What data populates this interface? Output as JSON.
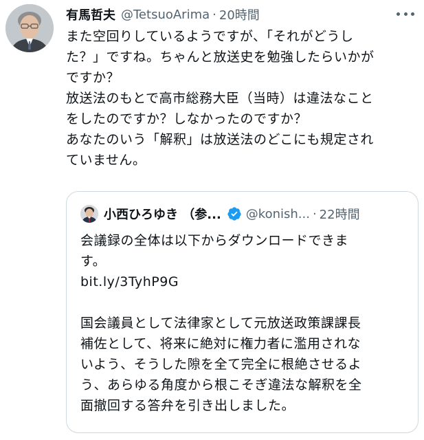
{
  "tweet": {
    "display_name": "有馬哲夫",
    "handle": "@TetsuoArima",
    "separator": "·",
    "time": "20時間",
    "lines": [
      "また空回りしているようですが、「それがどうし",
      "た？」ですね。ちゃんと放送史を勉強したらいかが",
      "ですか？",
      "放送法のもとで高市総務大臣（当時）は違法なこと",
      "をしたのですか？しなかったのですか？",
      "あなたのいう「解釈」は放送法のどこにも規定され",
      "ていません。"
    ]
  },
  "quoted": {
    "display_name": "小西ひろゆき （参...",
    "handle": "@konish...",
    "separator": "·",
    "time": "22時間",
    "lines": [
      "会議録の全体は以下からダウンロードできま",
      "す。",
      "bit.ly/3TyhP9G",
      "",
      "国会議員として法律家として元放送政策課課長",
      "補佐として、将来に絶対に権力者に濫用されな",
      "いよう、そうした隙を全て完全に根絶させるよ",
      "う、あらゆる角度から根こそぎ違法な解釈を全",
      "面撤回する答弁を引き出しました。"
    ]
  },
  "icons": {
    "more": "more-icon",
    "verified": "verified-badge-icon"
  },
  "colors": {
    "text": "#0f1419",
    "secondary": "#536471",
    "verified": "#1d9bf0",
    "border": "#cfd9de"
  }
}
